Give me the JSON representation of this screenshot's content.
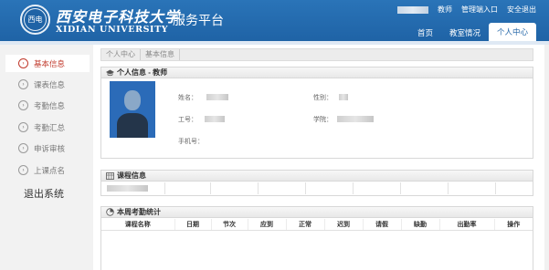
{
  "brand": {
    "logo_text": "西电",
    "name_cn": "西安电子科技大学",
    "name_en": "XIDIAN UNIVERSITY",
    "platform": "服务平台"
  },
  "topbar": {
    "role": "教师",
    "admin_link": "管理端入口",
    "logout_link": "安全退出"
  },
  "nav": {
    "tabs": [
      {
        "label": "首页"
      },
      {
        "label": "教室情况"
      },
      {
        "label": "个人中心"
      }
    ],
    "active_index": 2
  },
  "sidebar": {
    "items": [
      {
        "label": "基本信息",
        "active": true
      },
      {
        "label": "课表信息",
        "active": false
      },
      {
        "label": "考勤信息",
        "active": false
      },
      {
        "label": "考勤汇总",
        "active": false
      },
      {
        "label": "申诉审核",
        "active": false
      },
      {
        "label": "上课点名",
        "active": false
      }
    ],
    "logout": "退出系统"
  },
  "breadcrumb": [
    "个人中心",
    "基本信息"
  ],
  "personal_info": {
    "title": "个人信息 - 教师",
    "fields": {
      "name_label": "姓名：",
      "gender_label": "性别：",
      "id_label": "工号：",
      "college_label": "学院：",
      "phone_label": "手机号："
    }
  },
  "course_info": {
    "title": "课程信息"
  },
  "weekly_stats": {
    "title": "本周考勤统计",
    "columns": [
      "课程名称",
      "日期",
      "节次",
      "应到",
      "正常",
      "迟到",
      "请假",
      "缺勤",
      "出勤率",
      "操作"
    ]
  },
  "colors": {
    "header_blue": "#1f63a6",
    "active_red": "#c0392b"
  }
}
